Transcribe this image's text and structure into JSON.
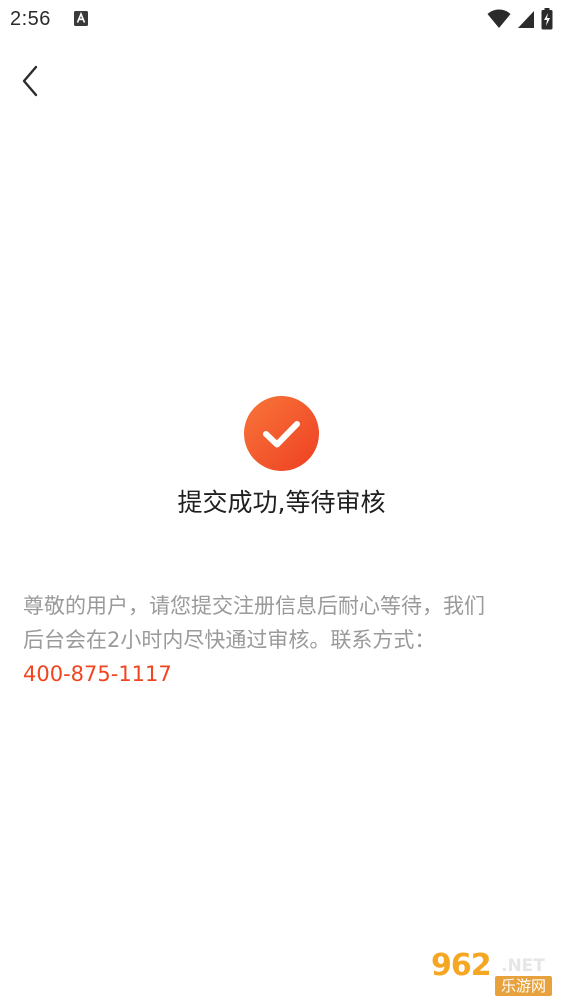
{
  "status_bar": {
    "time": "2:56",
    "app_icon": "a-letter-icon",
    "wifi_icon": "wifi-icon",
    "signal_icon": "cell-signal-icon",
    "battery_icon": "battery-charging-icon"
  },
  "header": {
    "back_icon": "chevron-left-icon"
  },
  "result": {
    "icon": "check-circle-icon",
    "title": "提交成功,等待审核",
    "accent_color": "#f0451f"
  },
  "notice": {
    "line1": "尊敬的用户，请您提交注册信息后耐心等待，我们",
    "line2": "后台会在2小时内尽快通过审核。联系方式：",
    "phone": "400-875-1117"
  },
  "watermark": {
    "brand": "962",
    "suffix": ".NET",
    "sub": "乐游网"
  }
}
